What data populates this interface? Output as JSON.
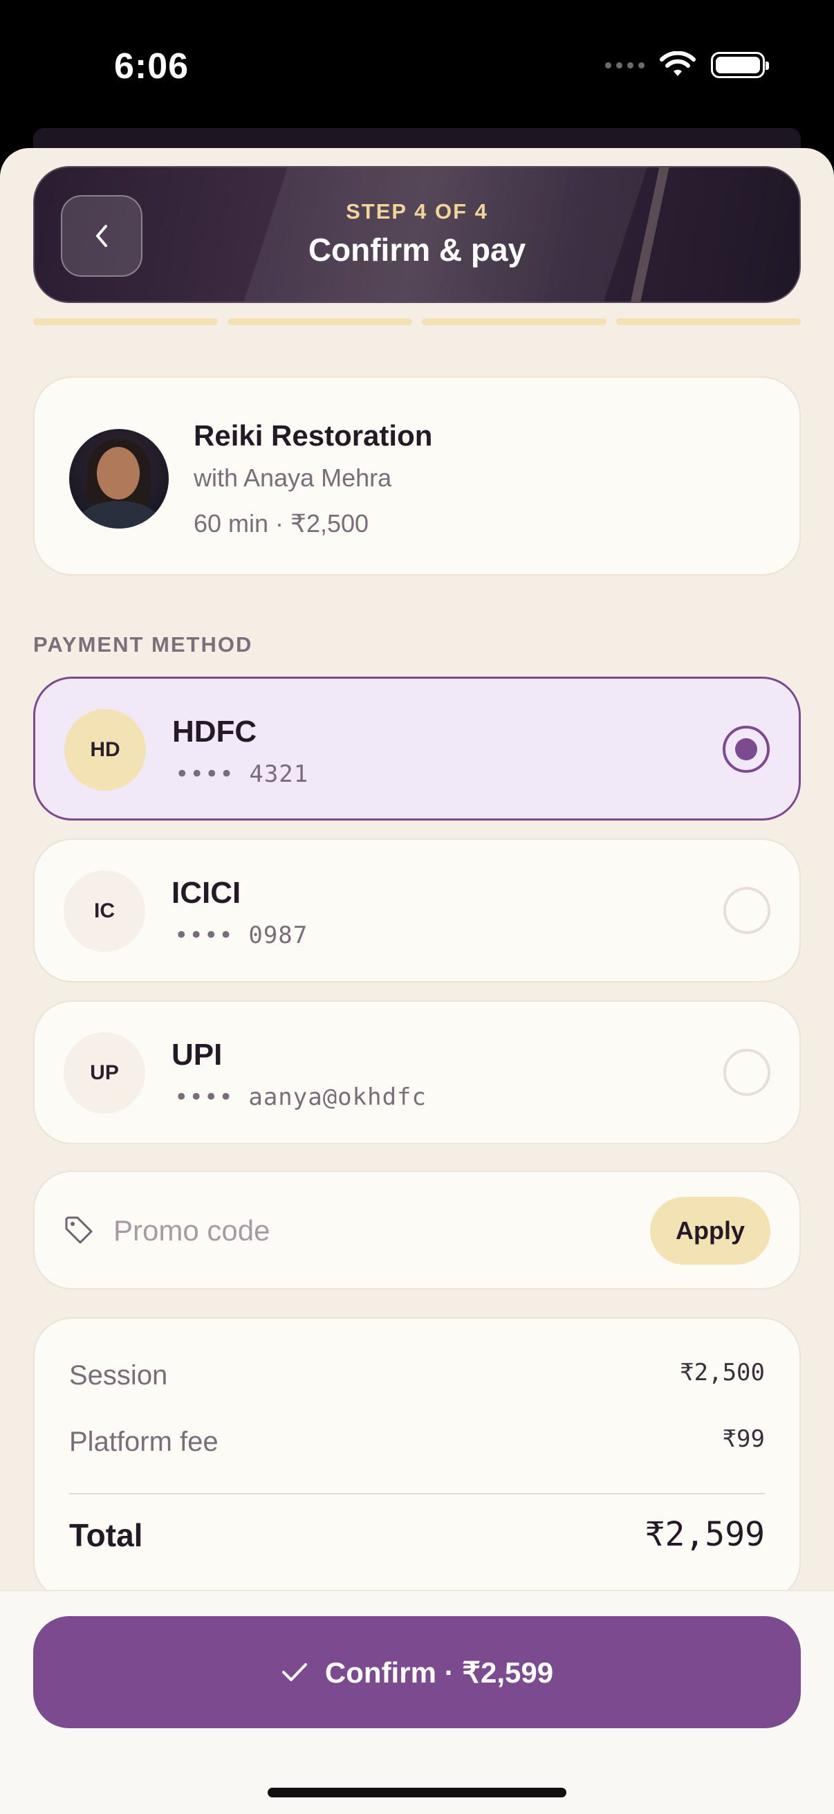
{
  "status_bar": {
    "time": "6:06"
  },
  "header": {
    "step": "STEP 4 OF 4",
    "title": "Confirm & pay"
  },
  "session": {
    "title": "Reiki Restoration",
    "practitioner": "with Anaya Mehra",
    "meta": "60 min · ₹2,500"
  },
  "payment": {
    "section_label": "PAYMENT METHOD",
    "methods": [
      {
        "badge": "HD",
        "name": "HDFC",
        "number": "•••• 4321",
        "selected": true
      },
      {
        "badge": "IC",
        "name": "ICICI",
        "number": "•••• 0987",
        "selected": false
      },
      {
        "badge": "UP",
        "name": "UPI",
        "number": "•••• aanya@okhdfc",
        "selected": false
      }
    ]
  },
  "promo": {
    "placeholder": "Promo code",
    "apply_label": "Apply"
  },
  "summary": {
    "session_label": "Session",
    "session_value": "₹2,500",
    "fee_label": "Platform fee",
    "fee_value": "₹99",
    "total_label": "Total",
    "total_value": "₹2,599"
  },
  "confirm": {
    "label": "Confirm · ₹2,599"
  },
  "colors": {
    "accent": "#7c4a8f",
    "gold": "#f3e2b3",
    "background": "#f5eee4"
  }
}
